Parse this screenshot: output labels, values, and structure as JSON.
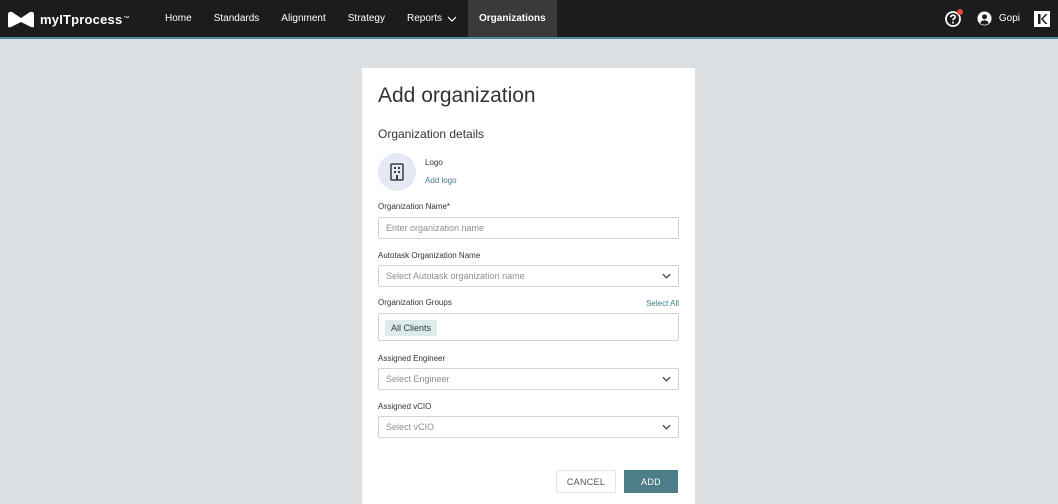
{
  "app": {
    "brand": "myITprocess",
    "brand_tm": "™"
  },
  "nav": {
    "items": [
      {
        "label": "Home"
      },
      {
        "label": "Standards"
      },
      {
        "label": "Alignment"
      },
      {
        "label": "Strategy"
      },
      {
        "label": "Reports"
      },
      {
        "label": "Organizations"
      }
    ],
    "active": "Organizations"
  },
  "user": {
    "name": "Gopi"
  },
  "colors": {
    "accent": "#4d7d86",
    "link": "#3e7c88",
    "topbar": "#1c1c1c",
    "notification": "#e5483f"
  },
  "form": {
    "title": "Add organization",
    "section": "Organization details",
    "logo_label": "Logo",
    "add_logo": "Add logo",
    "org_name_label": "Organization Name*",
    "org_name_placeholder": "Enter organization name",
    "autotask_label": "Autotask Organization Name",
    "autotask_placeholder": "Select Autotask organization name",
    "groups_label": "Organization Groups",
    "select_all": "Select All",
    "groups": [
      "All Clients"
    ],
    "engineer_label": "Assigned Engineer",
    "engineer_placeholder": "Select Engineer",
    "vcio_label": "Assigned vCIO",
    "vcio_placeholder": "Select vCIO",
    "cancel": "CANCEL",
    "add": "ADD"
  }
}
